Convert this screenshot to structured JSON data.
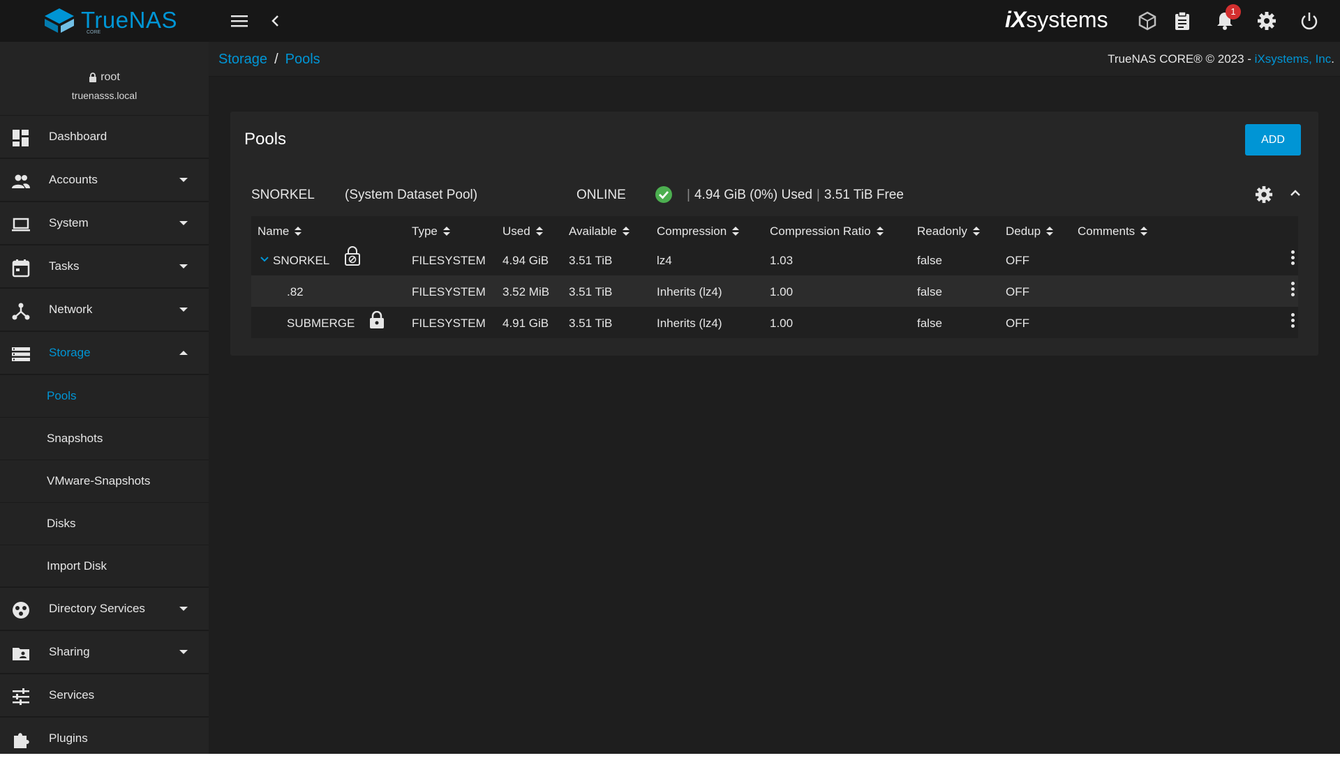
{
  "app": {
    "logo_text": "TrueNAS",
    "logo_sub": "CORE",
    "vendor_logo_ix": "iX",
    "vendor_logo_systems": "systems",
    "notification_count": "1"
  },
  "sidebar": {
    "user": "root",
    "host": "truenasss.local",
    "items": [
      {
        "label": "Dashboard",
        "icon": "dashboard-icon"
      },
      {
        "label": "Accounts",
        "icon": "accounts-icon"
      },
      {
        "label": "System",
        "icon": "laptop-icon"
      },
      {
        "label": "Tasks",
        "icon": "calendar-icon"
      },
      {
        "label": "Network",
        "icon": "network-icon"
      },
      {
        "label": "Storage",
        "icon": "storage-icon"
      },
      {
        "label": "Directory Services",
        "icon": "directory-services-icon"
      },
      {
        "label": "Sharing",
        "icon": "folder-shared-icon"
      },
      {
        "label": "Services",
        "icon": "tune-icon"
      },
      {
        "label": "Plugins",
        "icon": "puzzle-icon"
      }
    ],
    "storage_sub": [
      "Pools",
      "Snapshots",
      "VMware-Snapshots",
      "Disks",
      "Import Disk"
    ]
  },
  "breadcrumb": {
    "parent": "Storage",
    "sep": "/",
    "current": "Pools"
  },
  "copyright": {
    "text": "TrueNAS CORE® © 2023 - ",
    "link": "iXsystems, Inc",
    "end": "."
  },
  "page": {
    "title": "Pools",
    "add_label": "ADD"
  },
  "pool": {
    "name": "SNORKEL",
    "desc": "(System Dataset Pool)",
    "status": "ONLINE",
    "used": "4.94 GiB (0%) Used",
    "free": "3.51 TiB Free",
    "stat_sep": "|"
  },
  "table": {
    "headers": [
      "Name",
      "Type",
      "Used",
      "Available",
      "Compression",
      "Compression Ratio",
      "Readonly",
      "Dedup",
      "Comments"
    ],
    "rows": [
      {
        "name": "SNORKEL",
        "type": "FILESYSTEM",
        "used": "4.94 GiB",
        "available": "3.51 TiB",
        "compression": "lz4",
        "ratio": "1.03",
        "readonly": "false",
        "dedup": "OFF",
        "comments": ""
      },
      {
        "name": ".82",
        "type": "FILESYSTEM",
        "used": "3.52 MiB",
        "available": "3.51 TiB",
        "compression": "Inherits (lz4)",
        "ratio": "1.00",
        "readonly": "false",
        "dedup": "OFF",
        "comments": ""
      },
      {
        "name": "SUBMERGE",
        "type": "FILESYSTEM",
        "used": "4.91 GiB",
        "available": "3.51 TiB",
        "compression": "Inherits (lz4)",
        "ratio": "1.00",
        "readonly": "false",
        "dedup": "OFF",
        "comments": ""
      }
    ]
  },
  "colors": {
    "accent": "#0095d5",
    "ok": "#4caf50",
    "badge": "#d32f2f"
  }
}
